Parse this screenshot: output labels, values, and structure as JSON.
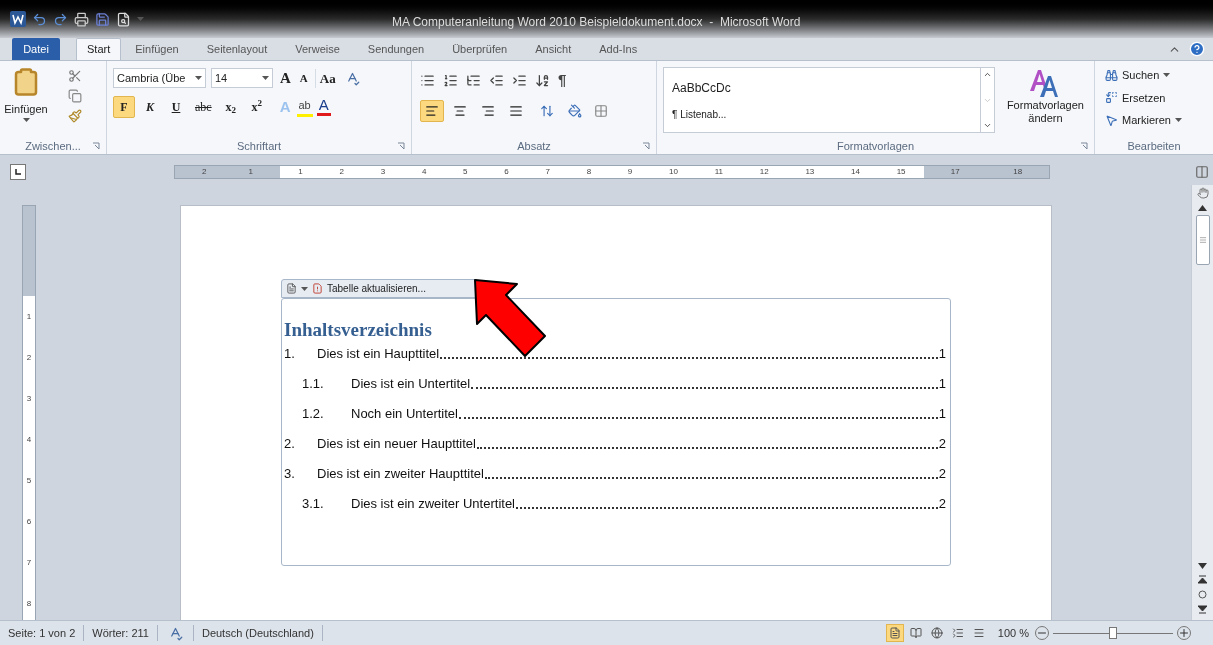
{
  "window": {
    "title": "MA Computeranleitung Word 2010 Beispieldokument.docx  -  Microsoft Word"
  },
  "file_tab": "Datei",
  "tabs": [
    {
      "label": "Start",
      "selected": true
    },
    {
      "label": "Einfügen",
      "selected": false
    },
    {
      "label": "Seitenlayout",
      "selected": false
    },
    {
      "label": "Verweise",
      "selected": false
    },
    {
      "label": "Sendungen",
      "selected": false
    },
    {
      "label": "Überprüfen",
      "selected": false
    },
    {
      "label": "Ansicht",
      "selected": false
    },
    {
      "label": "Add-Ins",
      "selected": false
    }
  ],
  "ribbon": {
    "clipboard": {
      "paste": "Einfügen",
      "group": "Zwischen..."
    },
    "font": {
      "name": "Cambria (Übe",
      "size": "14",
      "grow": "A",
      "shrink": "A",
      "change_case": "Aa",
      "effects": "A",
      "highlight": "ab",
      "font_color_label": "A",
      "group": "Schriftart",
      "styles": [
        {
          "label": "F",
          "kind": "bold",
          "selected": true
        },
        {
          "label": "K",
          "kind": "italic",
          "selected": false
        },
        {
          "label": "U",
          "kind": "underline",
          "selected": false
        },
        {
          "label": "abc",
          "kind": "strike",
          "selected": false
        },
        {
          "label": "x$_{2}$",
          "kind": "plain",
          "selected": false
        },
        {
          "label": "x$^{2}$",
          "kind": "plain",
          "selected": false
        }
      ]
    },
    "paragraph": {
      "pilcrow": "¶",
      "group": "Absatz",
      "align": [
        {
          "kind": "left",
          "selected": true
        },
        {
          "kind": "center",
          "selected": false
        },
        {
          "kind": "right",
          "selected": false
        },
        {
          "kind": "justify",
          "selected": false
        }
      ]
    },
    "styles": {
      "gallery": [
        "AaBbCcDc",
        "¶ Listenab..."
      ],
      "change": "Formatvorlagen ändern",
      "group": "Formatvorlagen"
    },
    "editing": {
      "items": [
        "Suchen",
        "Ersetzen",
        "Markieren"
      ],
      "group": "Bearbeiten"
    }
  },
  "ruler": {
    "labels": [
      "2",
      "1",
      "1",
      "2",
      "3",
      "4",
      "5",
      "6",
      "7",
      "8",
      "9",
      "10",
      "11",
      "12",
      "13",
      "14",
      "15",
      "17",
      "18"
    ],
    "vertical_labels": [
      "1",
      "2",
      "3",
      "4",
      "5",
      "6",
      "7",
      "8"
    ]
  },
  "document": {
    "toc": {
      "toolbar": "Tabelle aktualisieren...",
      "heading": "Inhaltsverzeichnis",
      "entries": [
        {
          "number": "1.",
          "text": "Dies ist ein Haupttitel",
          "page": "1",
          "children": [
            {
              "number": "1.1.",
              "text": "Dies ist ein Untertitel",
              "page": "1"
            },
            {
              "number": "1.2.",
              "text": "Noch ein Untertitel",
              "page": "1"
            }
          ]
        },
        {
          "number": "2.",
          "text": "Dies ist ein neuer Haupttitel",
          "page": "2"
        },
        {
          "number": "3.",
          "text": "Dies ist ein zweiter Haupttitel",
          "page": "2",
          "children": [
            {
              "number": "3.1.",
              "text": "Dies ist ein zweiter Untertitel",
              "page": "2"
            }
          ]
        }
      ]
    }
  },
  "status_bar": {
    "page": "Seite: 1 von 2",
    "words": "Wörter: 211",
    "language": "Deutsch (Deutschland)",
    "views": [
      {
        "kind": "print",
        "selected": true
      },
      {
        "kind": "read",
        "selected": false
      },
      {
        "kind": "web",
        "selected": false
      },
      {
        "kind": "outline",
        "selected": false
      },
      {
        "kind": "draft",
        "selected": false
      }
    ],
    "zoom": "100 %",
    "zoom_slider": {
      "level": 0.5
    }
  }
}
